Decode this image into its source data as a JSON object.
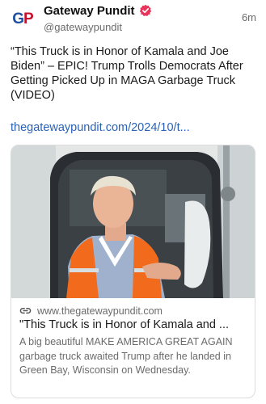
{
  "post": {
    "author_name": "Gateway Pundit",
    "handle": "@gatewaypundit",
    "timestamp": "6m",
    "avatar_text_g": "G",
    "avatar_text_p": "P",
    "text": "“This Truck is in Honor of Kamala and Joe Biden” – EPIC! Trump Trolls Democrats After Getting Picked Up in MAGA Garbage Truck (VIDEO)",
    "link": "thegatewaypundit.com/2024/10/t..."
  },
  "link_card": {
    "domain": "www.thegatewaypundit.com",
    "title": "\"This Truck is in Honor of Kamala and ...",
    "description": "A big beautiful MAKE AMERICA GREAT AGAIN garbage truck awaited Trump after he landed in Green Bay, Wisconsin on Wednesday."
  },
  "colors": {
    "link": "#2a62b8",
    "verified_badge": "#e8345a",
    "avatar_blue": "#1f4f9e",
    "avatar_red": "#c8102e",
    "safety_vest": "#f26a1b"
  },
  "icons": {
    "verified": "verified-badge-icon",
    "link": "link-chain-icon"
  }
}
